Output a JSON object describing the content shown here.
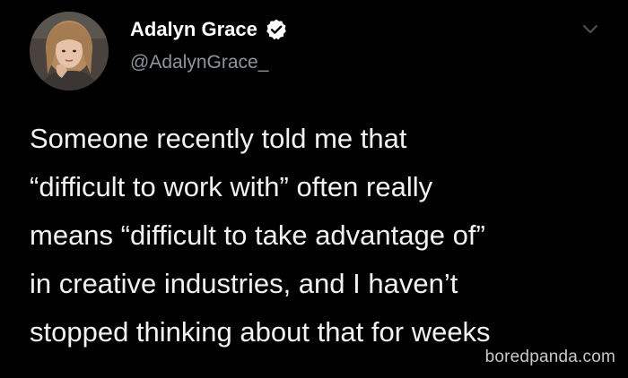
{
  "tweet": {
    "author": {
      "name": "Adalyn Grace",
      "handle": "@AdalynGrace_",
      "verified": true,
      "avatar_icon": "avatar-photo"
    },
    "menu_icon": "chevron-down-icon",
    "text_lines": [
      "Someone recently told me that",
      "“difficult to work with” often really",
      "means “difficult to take advantage of”",
      "in creative industries, and I haven’t",
      "stopped thinking about that for weeks"
    ]
  },
  "watermark": "boredpanda.com",
  "colors": {
    "background": "#000000",
    "text": "#f2f2f2",
    "handle": "#8b959e",
    "verified_badge": "#ffffff"
  }
}
